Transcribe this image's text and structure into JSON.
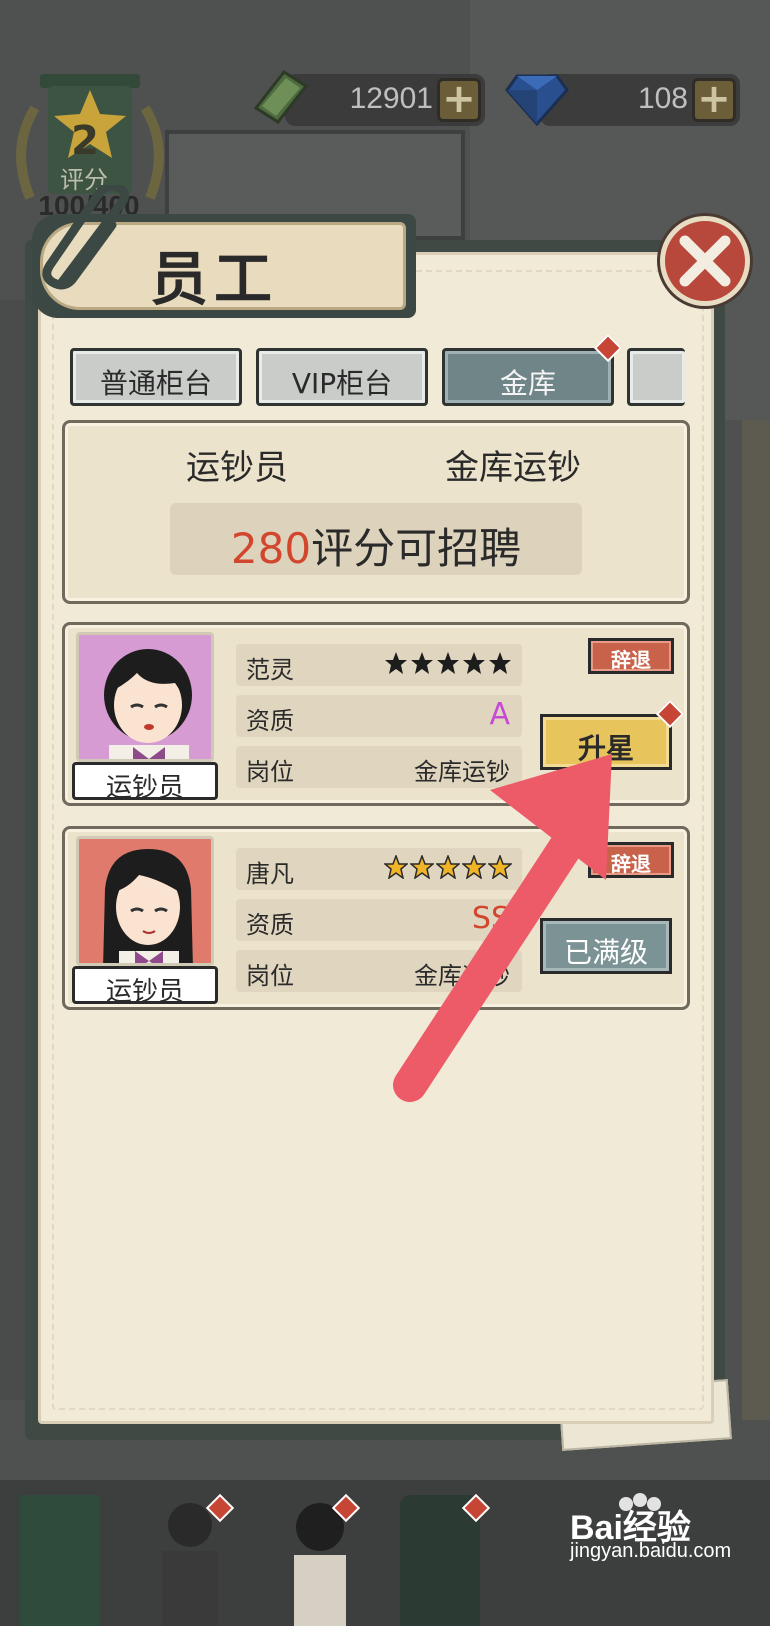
{
  "currency": {
    "money_value": "12901",
    "gem_value": "108",
    "plus_glyph": "+",
    "money_icon": "banknote-stack-icon",
    "gem_icon": "blue-diamond-icon"
  },
  "rating": {
    "level": "2",
    "label": "评分",
    "score": "100/400"
  },
  "dialog": {
    "title": "员工",
    "close_icon": "close-x-icon"
  },
  "tabs": [
    {
      "label": "普通柜台",
      "active": false,
      "has_alert": false
    },
    {
      "label": "VIP柜台",
      "active": false,
      "has_alert": false
    },
    {
      "label": "金库",
      "active": true,
      "has_alert": true
    },
    {
      "label": "",
      "active": false,
      "has_alert": false
    }
  ],
  "job": {
    "role": "运钞员",
    "post": "金库运钞",
    "recruit_number": "280",
    "recruit_suffix": "评分可招聘"
  },
  "employees": [
    {
      "name": "范灵",
      "stars_filled": 5,
      "star_style": "black",
      "quality_label": "资质",
      "quality": "A",
      "post_label": "岗位",
      "post": "金库运钞",
      "role_tag": "运钞员",
      "dismiss_label": "辞退",
      "action_label": "升星",
      "action_has_alert": true
    },
    {
      "name": "唐凡",
      "stars_filled": 5,
      "star_style": "gold",
      "quality_label": "资质",
      "quality": "SS",
      "post_label": "岗位",
      "post": "金库运钞",
      "role_tag": "运钞员",
      "dismiss_label": "辞退",
      "action_label": "已满级",
      "action_has_alert": false
    }
  ],
  "watermark": {
    "brand": "Bai经验",
    "url": "jingyan.baidu.com"
  },
  "colors": {
    "accent_red": "#d2462e",
    "tab_active": "#6f8587",
    "upgrade_yellow": "#e7c45c",
    "maxed_gray": "#7c9396",
    "dismiss_red": "#c8624a",
    "arrow_pink": "#ee5b68"
  }
}
